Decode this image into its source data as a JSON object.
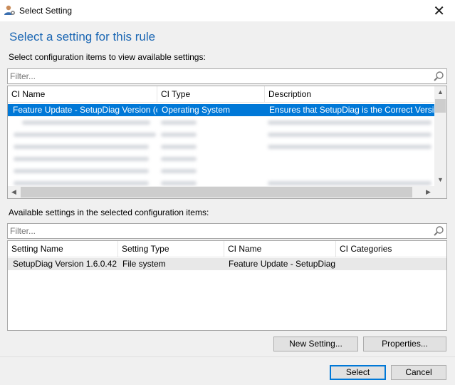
{
  "window": {
    "title": "Select Setting",
    "icon": "user-settings-icon",
    "close_glyph": "✕"
  },
  "heading": "Select a setting for this rule",
  "ci_section": {
    "label": "Select configuration items to view available settings:",
    "filter_placeholder": "Filter...",
    "columns": [
      "CI Name",
      "CI Type",
      "Description"
    ],
    "selected_row": {
      "ci_name": "Feature Update - SetupDiag Version (cur...",
      "ci_type": "Operating System",
      "description": "Ensures that SetupDiag is the Correct Version"
    }
  },
  "settings_section": {
    "label": "Available settings in the selected configuration items:",
    "filter_placeholder": "Filter...",
    "columns": [
      "Setting Name",
      "Setting Type",
      "CI Name",
      "CI Categories"
    ],
    "rows": [
      {
        "setting_name": "SetupDiag Version 1.6.0.42 ...",
        "setting_type": "File system",
        "ci_name": "Feature Update - SetupDiag...",
        "ci_categories": ""
      }
    ]
  },
  "buttons": {
    "new_setting": "New Setting...",
    "properties": "Properties...",
    "select": "Select",
    "cancel": "Cancel"
  },
  "colors": {
    "accent": "#0078d7",
    "heading": "#1a66b3"
  }
}
